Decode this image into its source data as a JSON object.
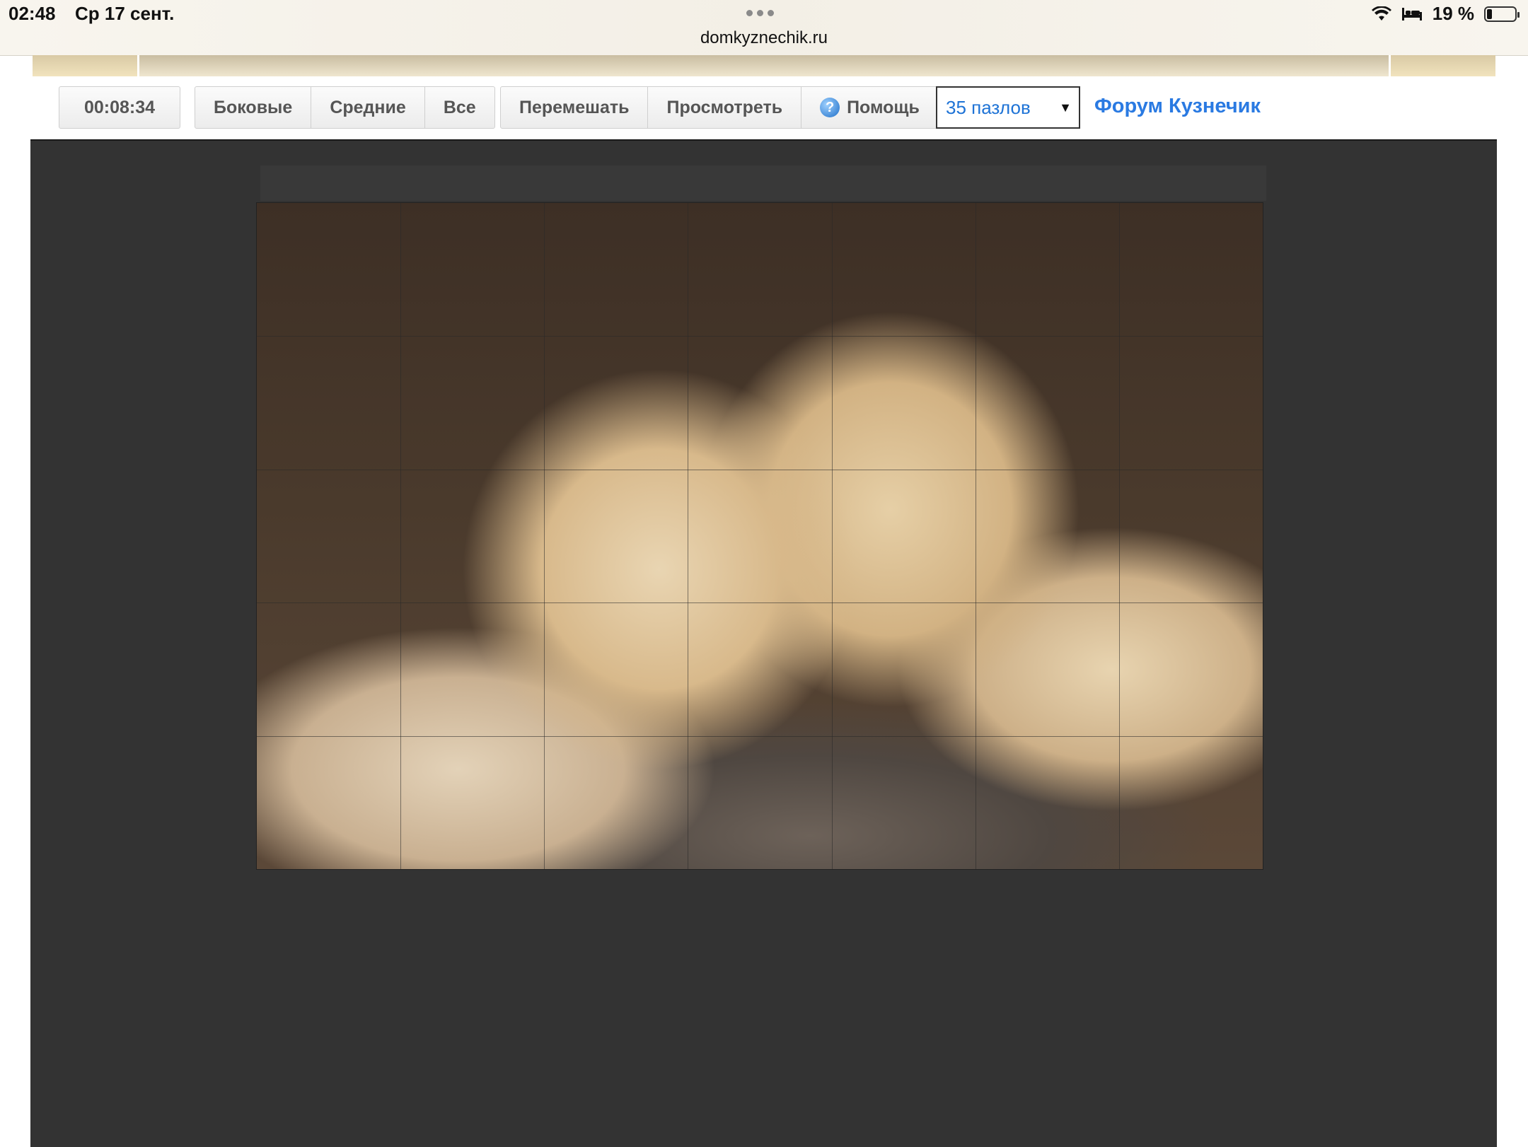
{
  "status_bar": {
    "time": "02:48",
    "date": "Ср 17 сент.",
    "battery_percent": "19 %",
    "battery_level": 0.19
  },
  "browser": {
    "url": "domkyznechik.ru"
  },
  "toolbar": {
    "timer": "00:08:34",
    "edges_side": "Боковые",
    "edges_middle": "Средние",
    "edges_all": "Все",
    "shuffle": "Перемешать",
    "preview": "Просмотреть",
    "help": "Помощь",
    "pieces_select_value": "35 пазлов",
    "forum_link": "Форум Кузнечик"
  },
  "puzzle": {
    "columns": 7,
    "rows": 5,
    "subject_icon": "lions-image"
  },
  "colors": {
    "board_background": "#333333",
    "link_blue": "#2a7ae2",
    "select_text": "#1e73d6"
  }
}
